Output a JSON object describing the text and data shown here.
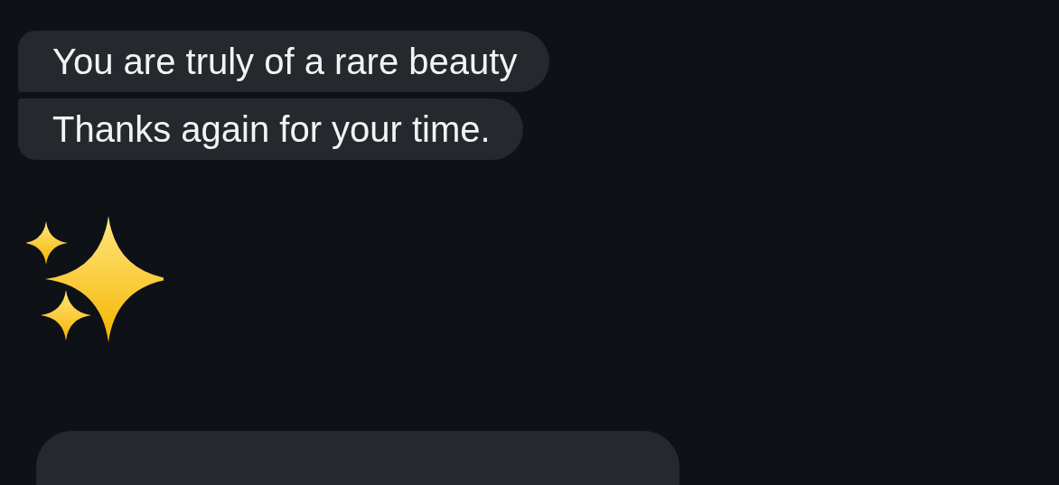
{
  "messages": [
    {
      "kind": "top",
      "text": "You are truly of a rare beauty"
    },
    {
      "kind": "bottom",
      "text": "Thanks again for your time."
    },
    {
      "kind": "sparkles"
    },
    {
      "kind": "partial"
    }
  ]
}
